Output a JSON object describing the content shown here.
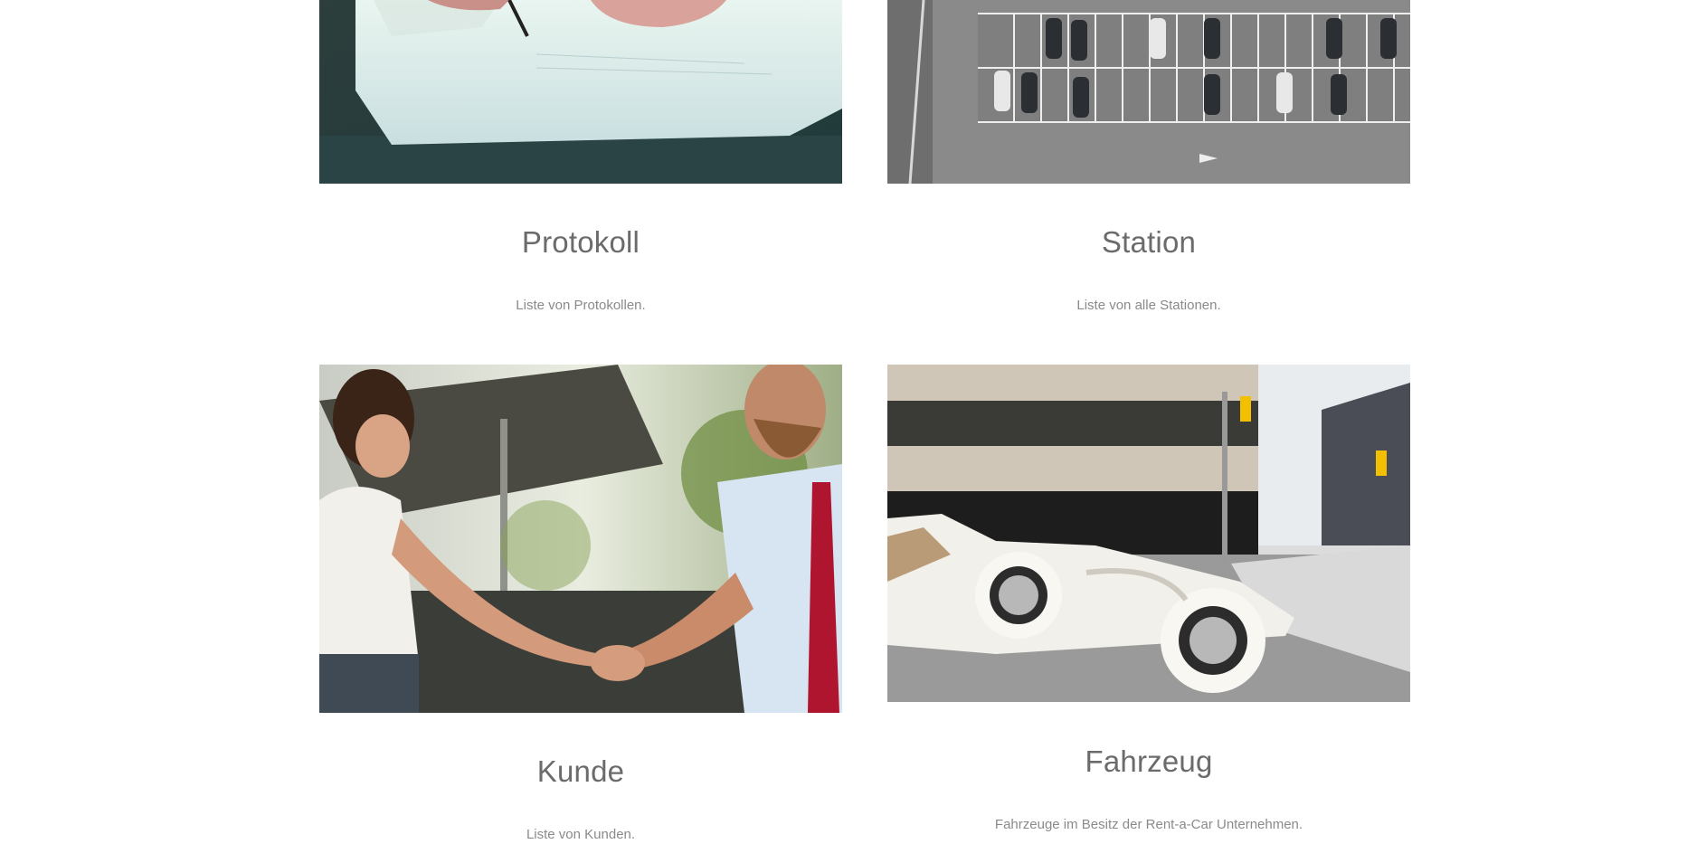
{
  "cards": [
    {
      "title": "Protokoll",
      "description": "Liste von Protokollen.",
      "image_icon": "document-signing-photo"
    },
    {
      "title": "Station",
      "description": "Liste von alle Stationen.",
      "image_icon": "parking-lot-aerial-photo"
    },
    {
      "title": "Kunde",
      "description": "Liste von Kunden.",
      "image_icon": "handshake-photo"
    },
    {
      "title": "Fahrzeug",
      "description": "Fahrzeuge im Besitz der Rent-a-Car Unternehmen.",
      "image_icon": "vintage-car-photo"
    }
  ],
  "colors": {
    "background": "#ffffff",
    "title_text": "#6b6b6b",
    "description_text": "#8a8a8a"
  }
}
